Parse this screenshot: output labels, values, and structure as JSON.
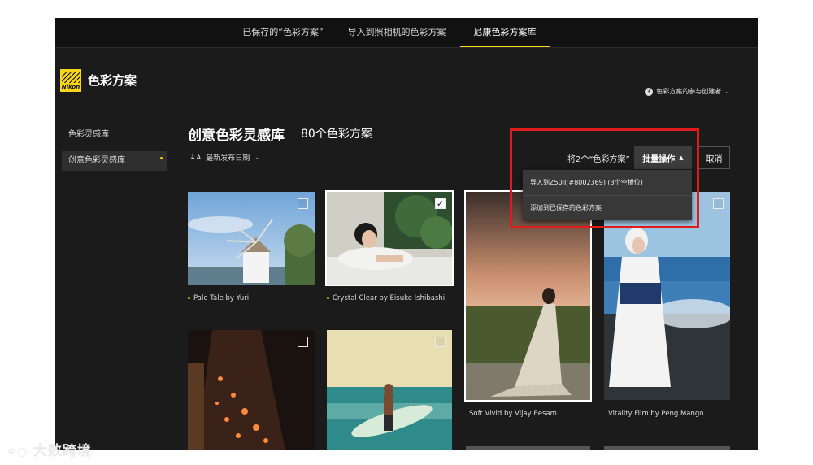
{
  "top_tabs": [
    {
      "label": "已保存的“色彩方案”",
      "active": false
    },
    {
      "label": "导入到照相机的色彩方案",
      "active": false
    },
    {
      "label": "尼康色彩方案库",
      "active": true
    }
  ],
  "brand": {
    "logo_text": "Nikon",
    "title": "色彩方案"
  },
  "help": {
    "icon": "help-icon",
    "label": "色彩方案的参与创建者"
  },
  "sidebar": {
    "items": [
      {
        "label": "色彩灵感库",
        "active": false
      },
      {
        "label": "创意色彩灵感库",
        "active": true
      }
    ]
  },
  "main": {
    "title": "创意色彩灵感库",
    "count": "80个色彩方案",
    "sort_label": "最新发布日期"
  },
  "selection": {
    "summary": "将2个“色彩方案”",
    "bulk_label": "批量操作",
    "cancel_label": "取消",
    "menu": [
      {
        "label": "导入到Z50II(#8002369) (3个空槽位)"
      },
      {
        "label": "添加到已保存的色彩方案"
      }
    ]
  },
  "cards": [
    {
      "caption": "Pale Tale by Yuri",
      "checked": false,
      "new_dot": true
    },
    {
      "caption": "Crystal Clear by Eisuke Ishibashi",
      "checked": true,
      "new_dot": true
    },
    {
      "caption": "Soft Vivid by Vijay Eesam",
      "checked": true,
      "new_dot": false
    },
    {
      "caption": "Vitality Film by Peng Mango",
      "checked": false,
      "new_dot": false
    },
    {
      "caption": "",
      "checked": false,
      "new_dot": false
    },
    {
      "caption": "",
      "checked": false,
      "new_dot": false
    }
  ],
  "watermark": "大数跨境",
  "colors": {
    "accent": "#f7d417",
    "highlight": "#e01b1b",
    "background": "#1b1b1b"
  }
}
